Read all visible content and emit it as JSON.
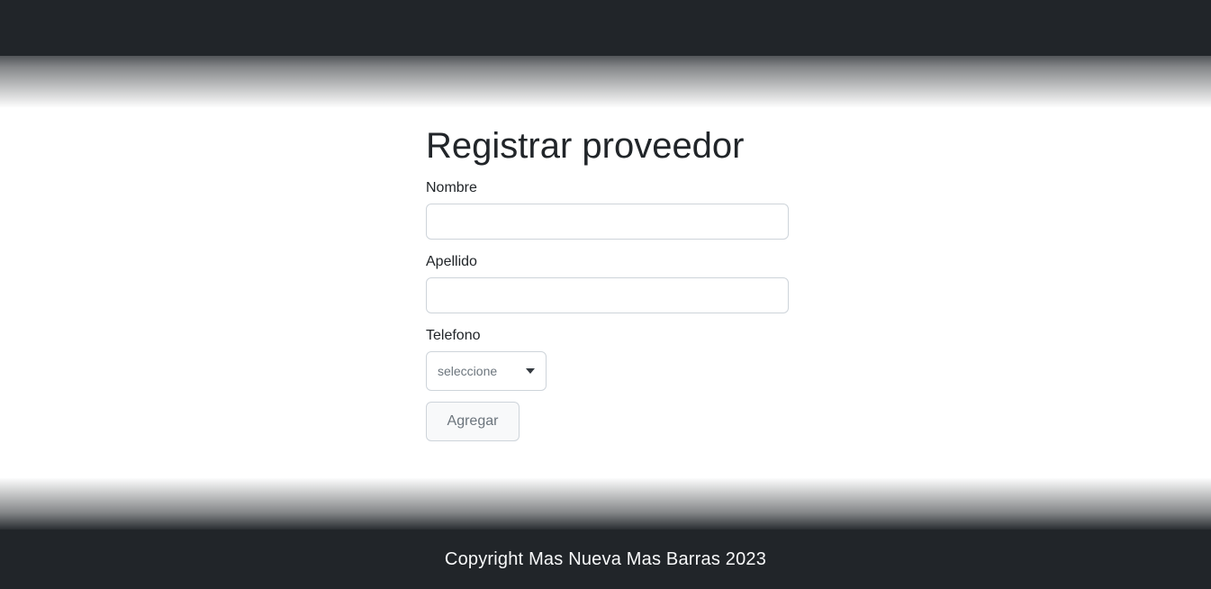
{
  "form": {
    "title": "Registrar proveedor",
    "fields": [
      {
        "label": "Nombre",
        "value": ""
      },
      {
        "label": "Apellido",
        "value": ""
      }
    ],
    "select": {
      "label": "Telefono",
      "value": "seleccione"
    },
    "submit_label": "Agregar"
  },
  "footer": {
    "text": "Copyright Mas Nueva Mas Barras 2023"
  },
  "colors": {
    "navbar": "#212529",
    "background": "#ffffff",
    "text": "#212529",
    "border": "#ced4da"
  }
}
